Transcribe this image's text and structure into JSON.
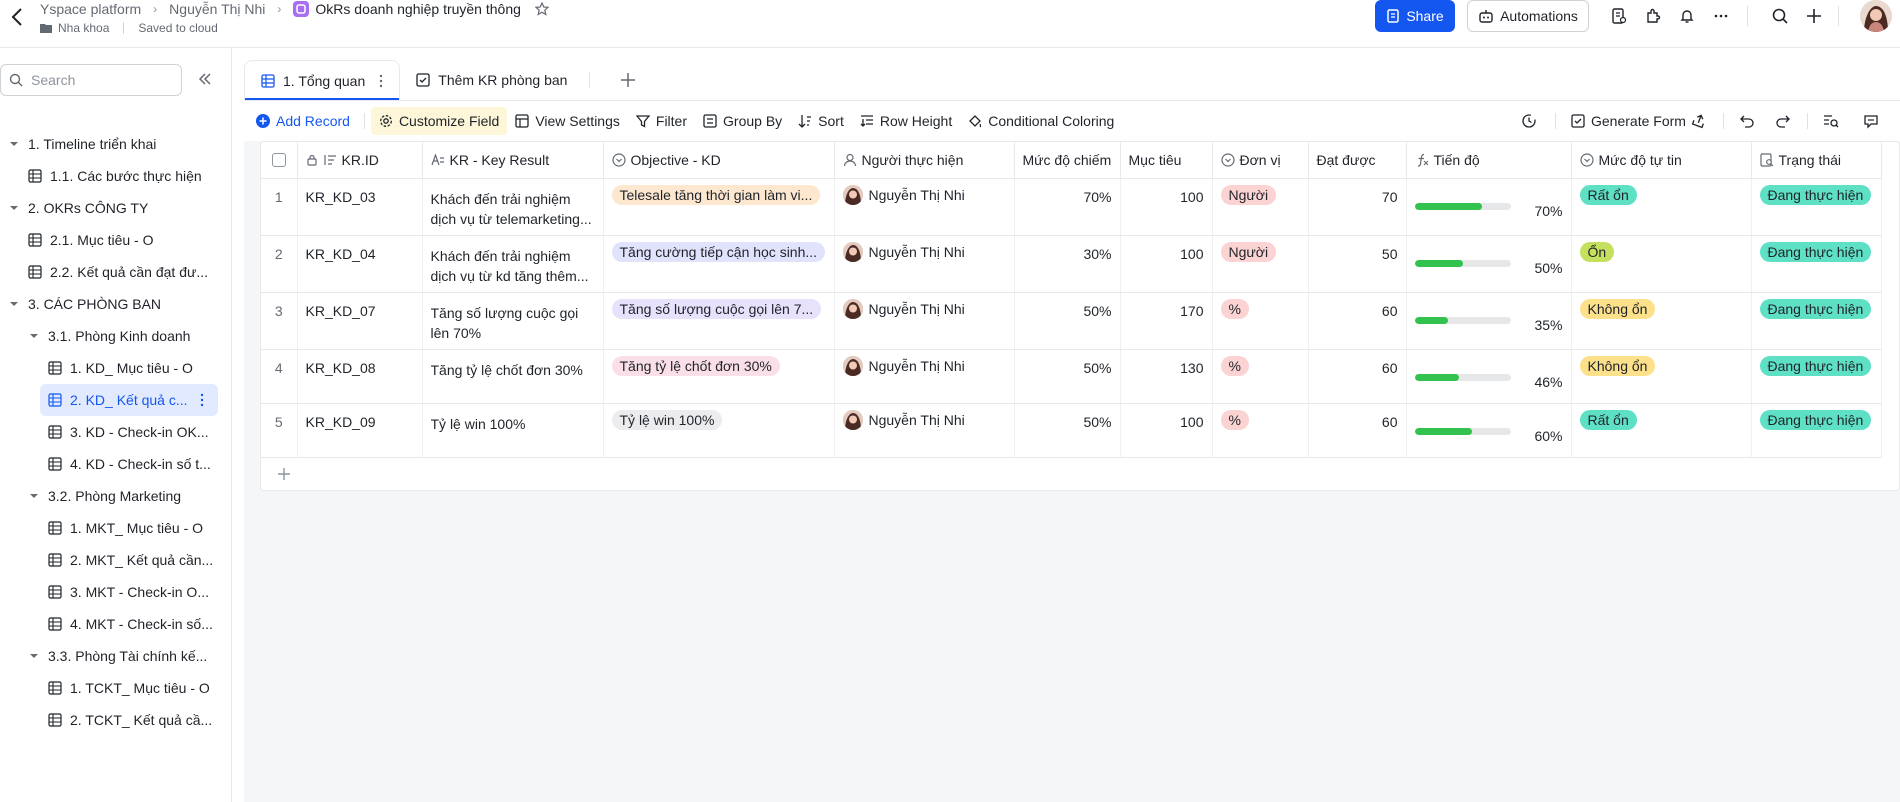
{
  "breadcrumb": {
    "workspace": "Yspace platform",
    "user": "Nguyễn Thị Nhi",
    "doc_title": "OkRs doanh nghiệp truyền thông",
    "folder": "Nha khoa",
    "save_status": "Saved to cloud"
  },
  "header": {
    "share_label": "Share",
    "automations_label": "Automations"
  },
  "sidebar": {
    "search_placeholder": "Search",
    "items": [
      {
        "label": "1. Timeline triển khai"
      },
      {
        "label": "1.1. Các bước thực hiện"
      },
      {
        "label": "2. OKRs CÔNG TY"
      },
      {
        "label": "2.1. Mục tiêu - O"
      },
      {
        "label": "2.2. Kết quả cần đạt đư..."
      },
      {
        "label": "3. CÁC PHÒNG BAN"
      },
      {
        "label": "3.1. Phòng Kinh doanh"
      },
      {
        "label": "1. KD_ Mục tiêu - O"
      },
      {
        "label": "2. KD_ Kết quả c..."
      },
      {
        "label": "3. KD - Check-in OK..."
      },
      {
        "label": "4. KD - Check-in số t..."
      },
      {
        "label": "3.2. Phòng Marketing"
      },
      {
        "label": "1. MKT_ Mục tiêu - O"
      },
      {
        "label": "2. MKT_ Kết quả cần..."
      },
      {
        "label": "3. MKT - Check-in O..."
      },
      {
        "label": "4. MKT - Check-in số..."
      },
      {
        "label": "3.3. Phòng Tài chính kế..."
      },
      {
        "label": "1. TCKT_ Mục tiêu - O"
      },
      {
        "label": "2. TCKT_ Kết quả cầ..."
      }
    ]
  },
  "tabs": [
    {
      "label": "1. Tổng quan"
    },
    {
      "label": "Thêm KR phòng ban"
    }
  ],
  "toolbar": {
    "add_record": "Add Record",
    "customize_field": "Customize Field",
    "view_settings": "View Settings",
    "filter": "Filter",
    "group_by": "Group By",
    "sort": "Sort",
    "row_height": "Row Height",
    "conditional_coloring": "Conditional Coloring",
    "generate_form": "Generate Form"
  },
  "table": {
    "columns": [
      "KR.ID",
      "KR - Key Result",
      "Objective - KD",
      "Người thực hiện",
      "Mức độ chiếm",
      "Mục tiêu",
      "Đơn vị",
      "Đạt được",
      "Tiến độ",
      "Mức độ tự tin",
      "Trạng thái"
    ],
    "rows": [
      {
        "n": "1",
        "id": "KR_KD_03",
        "kr": "Khách đến trải nghiệm dịch vụ từ telemarketing...",
        "objective": "Telesale tăng thời gian làm vi...",
        "person": "Nguyễn Thị  Nhi",
        "weight": "70%",
        "target": "100",
        "unit": "Người",
        "achieved": "70",
        "progress": 0.7,
        "progress_text": "70%",
        "confidence": "Rất ổn",
        "status": "Đang thực hiện"
      },
      {
        "n": "2",
        "id": "KR_KD_04",
        "kr": "Khách đến trải nghiệm dịch vụ từ kd tăng thêm...",
        "objective": "Tăng cường tiếp cận học sinh...",
        "person": "Nguyễn Thị  Nhi",
        "weight": "30%",
        "target": "100",
        "unit": "Người",
        "achieved": "50",
        "progress": 0.5,
        "progress_text": "50%",
        "confidence": "Ổn",
        "status": "Đang thực hiện"
      },
      {
        "n": "3",
        "id": "KR_KD_07",
        "kr": "Tăng số lượng cuộc gọi lên 70%",
        "objective": "Tăng số lượng cuộc gọi lên 7...",
        "person": "Nguyễn Thị  Nhi",
        "weight": "50%",
        "target": "170",
        "unit": "%",
        "achieved": "60",
        "progress": 0.35,
        "progress_text": "35%",
        "confidence": "Không ổn",
        "status": "Đang thực hiện"
      },
      {
        "n": "4",
        "id": "KR_KD_08",
        "kr": "Tăng tỷ lệ chốt đơn 30%",
        "objective": "Tăng tỷ lệ chốt đơn 30%",
        "person": "Nguyễn Thị  Nhi",
        "weight": "50%",
        "target": "130",
        "unit": "%",
        "achieved": "60",
        "progress": 0.46,
        "progress_text": "46%",
        "confidence": "Không ổn",
        "status": "Đang thực hiện"
      },
      {
        "n": "5",
        "id": "KR_KD_09",
        "kr": "Tỷ lệ win 100%",
        "objective": "Tỷ lệ win 100%",
        "person": "Nguyễn Thị  Nhi",
        "weight": "50%",
        "target": "100",
        "unit": "%",
        "achieved": "60",
        "progress": 0.6,
        "progress_text": "60%",
        "confidence": "Rất ổn",
        "status": "Đang thực hiện"
      }
    ]
  },
  "colors": {
    "accent": "#1456f0",
    "progress": "#32c24d",
    "objective_chips": [
      "#fde7cf",
      "#e1e3fc",
      "#e7e1fb",
      "#fbdfe8",
      "#ececee"
    ],
    "unit_chip": "#fbd3d3",
    "confidence": {
      "Rất ổn": "#5ee0c4",
      "Ổn": "#c5e05e",
      "Không ổn": "#fde08a"
    },
    "status_chip": "#5ee0c4"
  }
}
